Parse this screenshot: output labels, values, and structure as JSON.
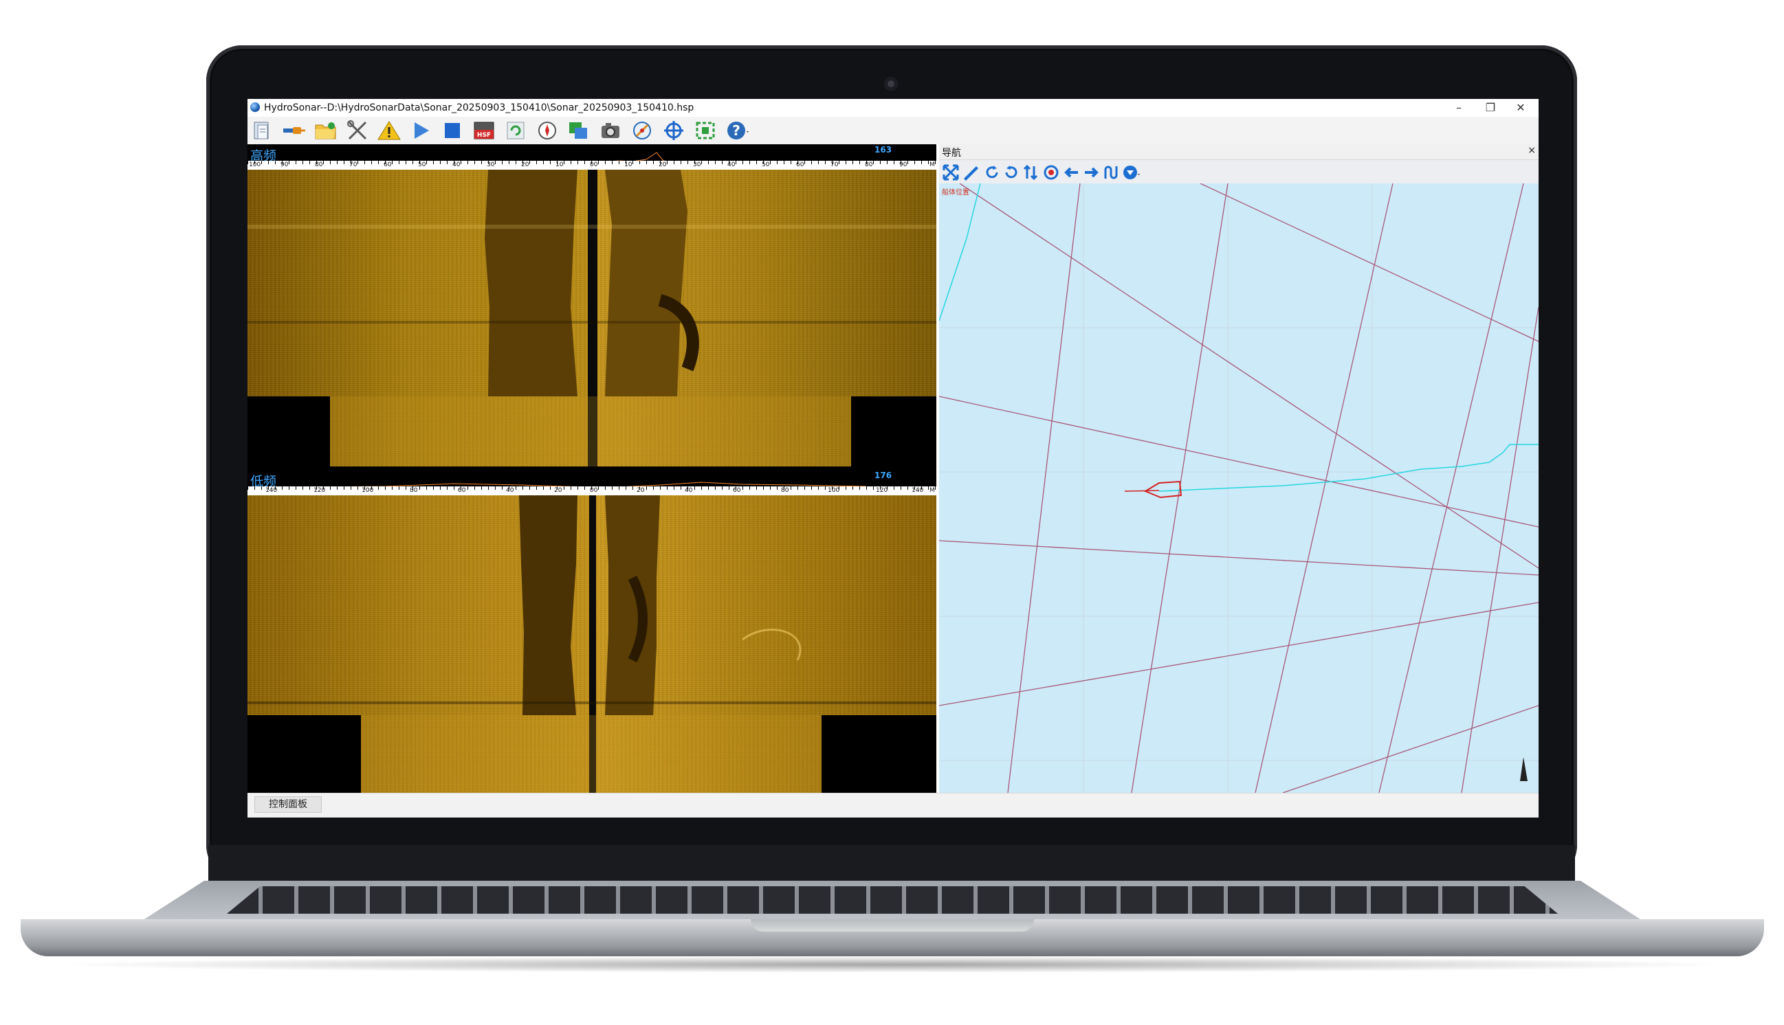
{
  "window": {
    "title": "HydroSonar--D:\\HydroSonarData\\Sonar_20250903_150410\\Sonar_20250903_150410.hsp",
    "minimize_label": "–",
    "restore_label": "❐",
    "close_label": "✕"
  },
  "toolbar": {
    "icons": [
      "open-file-icon",
      "signal-cable-icon",
      "folder-icon",
      "tools-icon",
      "warning-icon",
      "play-icon",
      "stop-icon",
      "hsf-icon",
      "refresh-icon",
      "compass-icon",
      "layers-icon",
      "camera-icon",
      "gps-icon",
      "crosshair-icon",
      "zoom-fit-icon",
      "help-icon"
    ],
    "hsf_label": "HSF"
  },
  "sonar": {
    "high": {
      "label": "高频",
      "value": "163",
      "ruler_left": [
        "100",
        "90",
        "80",
        "70",
        "60",
        "50",
        "40",
        "30",
        "20",
        "10"
      ],
      "ruler_right": [
        "00",
        "10",
        "20",
        "30",
        "40",
        "50",
        "60",
        "70",
        "80",
        "90"
      ],
      "ruler_unit": "M"
    },
    "low": {
      "label": "低频",
      "value": "176",
      "ruler_left": [
        "140",
        "120",
        "100",
        "80",
        "60",
        "40",
        "20"
      ],
      "ruler_right": [
        "00",
        "20",
        "40",
        "60",
        "80",
        "100",
        "120",
        "140"
      ],
      "ruler_unit": "M"
    }
  },
  "navigation": {
    "title": "导航",
    "close_label": "×",
    "tools": [
      "expand-icon",
      "ruler-icon",
      "rotate-cw-icon",
      "rotate-ccw-icon",
      "swap-vertical-icon",
      "compass-target-icon",
      "arrow-left-icon",
      "arrow-right-icon",
      "u-turn-icon",
      "filter-dropdown-icon"
    ],
    "map_label": "船体位置",
    "colors": {
      "water": "#cdeaf8",
      "grid": "#a85878",
      "track": "#24d6e0",
      "vessel": "#d22020"
    }
  },
  "status": {
    "panel_tab": "控制面板"
  }
}
